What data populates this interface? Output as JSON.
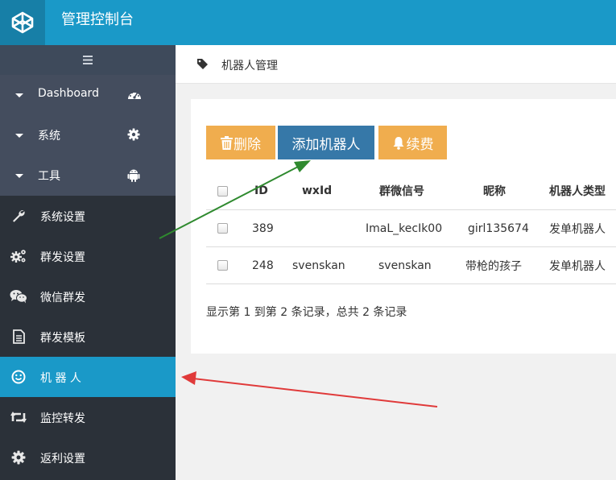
{
  "header": {
    "app_title": "管理控制台",
    "logo_icon": "codepen-cube-icon"
  },
  "sidebar": {
    "toggle_icon": "hamburger-icon",
    "top_items": [
      {
        "label": "Dashboard",
        "icon": "dashboard-gauge-icon"
      },
      {
        "label": "系统",
        "icon": "gear-icon"
      },
      {
        "label": "工具",
        "icon": "android-icon"
      }
    ],
    "items": [
      {
        "label": "系统设置",
        "icon": "wrench-icon"
      },
      {
        "label": "群发设置",
        "icon": "gears-icon"
      },
      {
        "label": "微信群发",
        "icon": "wechat-icon"
      },
      {
        "label": "群发模板",
        "icon": "document-icon"
      },
      {
        "label": "机 器 人",
        "icon": "smile-icon",
        "active": true
      },
      {
        "label": "监控转发",
        "icon": "retweet-icon"
      },
      {
        "label": "返利设置",
        "icon": "gear-icon"
      }
    ]
  },
  "breadcrumb": {
    "icon": "tag-icon",
    "text": "机器人管理"
  },
  "toolbar": {
    "delete_label": "删除",
    "add_label": "添加机器人",
    "renew_label": "续费"
  },
  "table": {
    "headers": [
      "ID",
      "wxId",
      "群微信号",
      "昵称",
      "机器人类型"
    ],
    "rows": [
      {
        "id": "389",
        "wxid": "",
        "group_wechat": "ImaL_kecIk00",
        "nickname": "girl135674",
        "type": "发单机器人"
      },
      {
        "id": "248",
        "wxid": "svenskan",
        "group_wechat": "svenskan",
        "nickname": "带枪的孩子",
        "type": "发单机器人"
      }
    ]
  },
  "summary": "显示第 1 到第 2 条记录，总共 2 条记录",
  "colors": {
    "topbar": "#1a99c8",
    "sidebar": "#2b3139",
    "active": "#1a99c8",
    "add_button": "#3678a8",
    "warn_button": "#f0ad4e"
  }
}
